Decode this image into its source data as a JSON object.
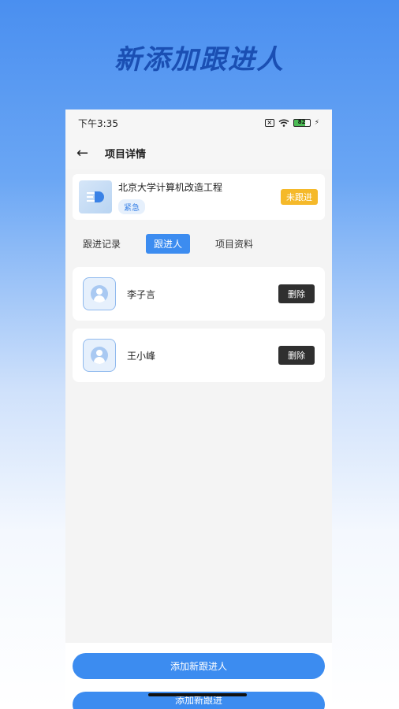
{
  "hero": {
    "title": "新添加跟进人"
  },
  "status_bar": {
    "time": "下午3:35",
    "battery": "82"
  },
  "nav": {
    "title": "项目详情"
  },
  "project": {
    "name": "北京大学计算机改造工程",
    "priority": "紧急",
    "status": "未跟进"
  },
  "tabs": [
    {
      "label": "跟进记录",
      "active": false
    },
    {
      "label": "跟进人",
      "active": true
    },
    {
      "label": "项目资料",
      "active": false
    }
  ],
  "persons": [
    {
      "name": "李子言",
      "delete_label": "删除"
    },
    {
      "name": "王小峰",
      "delete_label": "删除"
    }
  ],
  "actions": {
    "add_label": "添加新跟进人",
    "ghost_label": "添加新跟进"
  },
  "colors": {
    "accent": "#3c8cf0",
    "warning": "#f5b92a",
    "dark_button": "#2f2f2f"
  }
}
